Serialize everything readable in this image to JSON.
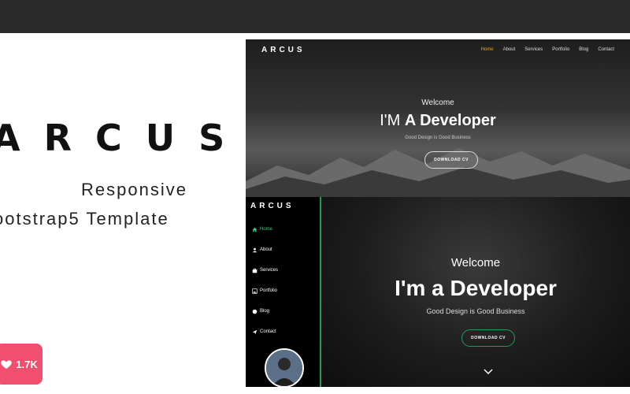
{
  "promo": {
    "brand": "ARCUS",
    "tagline_1": "Responsive",
    "tagline_2": "ootstrap5 Template",
    "likes": "1.7K"
  },
  "preview_1": {
    "logo": "ARCUS",
    "nav": [
      "Home",
      "About",
      "Services",
      "Portfolio",
      "Blog",
      "Contact"
    ],
    "active_nav": "Home",
    "welcome": "Welcome",
    "headline_prefix": "I'M ",
    "headline_bold": "A Developer",
    "subtitle": "Good Design is Good Business",
    "button": "DOWNLOAD CV"
  },
  "preview_2": {
    "logo": "ARCUS",
    "menu": [
      "Home",
      "About",
      "Services",
      "Portfolio",
      "Blog",
      "Contact"
    ],
    "welcome": "Welcome",
    "headline": "I'm a Developer",
    "subtitle": "Good Design is Good Business",
    "button": "DOWNLOAD CV"
  },
  "colors": {
    "accent_orange": "#f0a020",
    "accent_green": "#1f9b5a",
    "like_badge": "#f0506e"
  }
}
